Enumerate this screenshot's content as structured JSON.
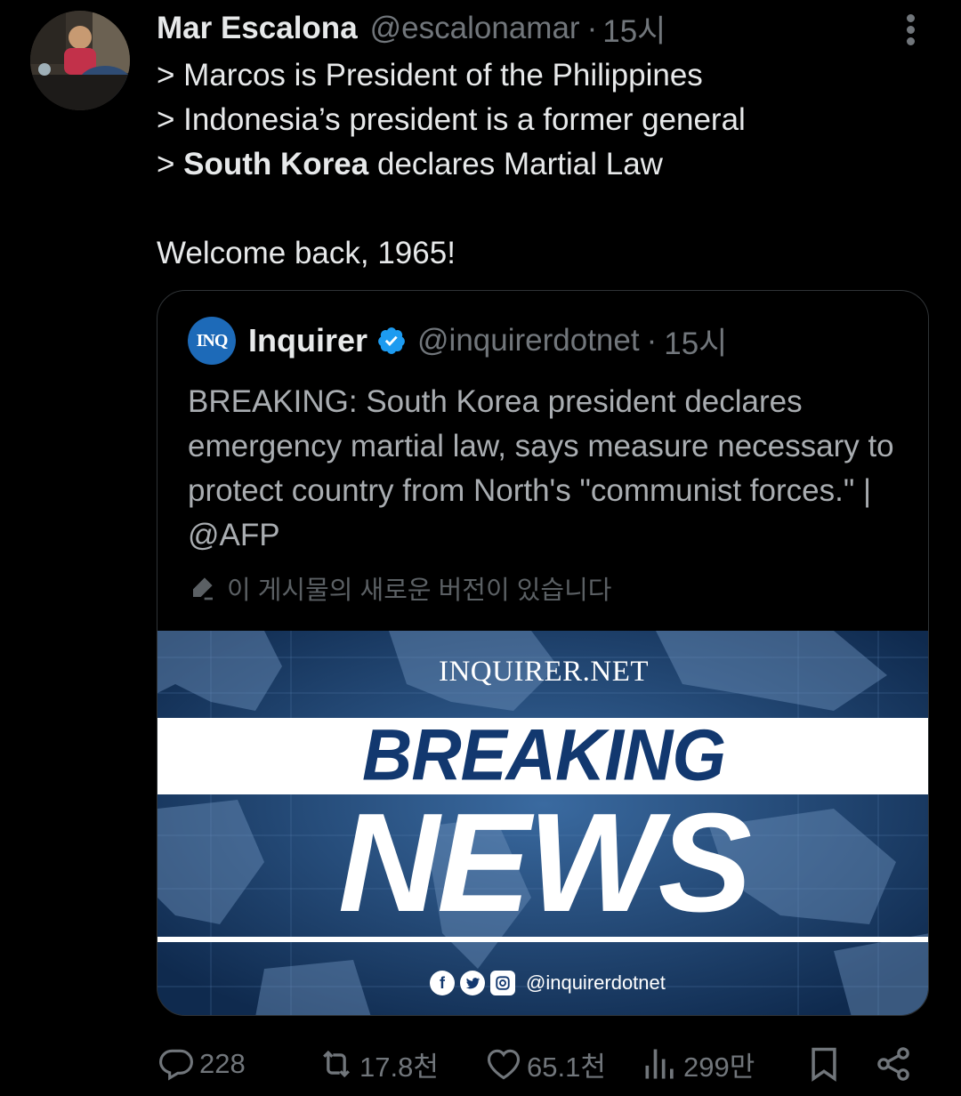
{
  "tweet": {
    "author_name": "Mar Escalona",
    "author_handle": "@escalonamar",
    "separator": "·",
    "time": "15시",
    "lines": [
      {
        "prefix": "> ",
        "bold": "",
        "text": "Marcos is President of the Philippines"
      },
      {
        "prefix": "> ",
        "bold": "",
        "text": "Indonesia’s president is a former general"
      },
      {
        "prefix": "> ",
        "bold": "South Korea",
        "text": " declares Martial Law"
      }
    ],
    "closing": "Welcome back, 1965!"
  },
  "quote": {
    "logo_text": "INQ",
    "name": "Inquirer",
    "handle": "@inquirerdotnet",
    "separator": "·",
    "time": "15시",
    "text": "BREAKING: South Korea president declares emergency martial law, says measure necessary to protect country from North's \"communist forces.\" | @AFP",
    "edited_note": "이 게시물의 새로운 버전이 있습니다",
    "media": {
      "site": "INQUIRER.NET",
      "headline_1": "BREAKING",
      "headline_2": "NEWS",
      "social_handle": "@inquirerdotnet"
    }
  },
  "actions": {
    "replies": "228",
    "reposts": "17.8천",
    "likes": "65.1천",
    "views": "299만"
  },
  "colors": {
    "background": "#000000",
    "text": "#e7e9ea",
    "muted": "#71767b",
    "verified": "#1d9bf0",
    "border": "#2f3336"
  }
}
